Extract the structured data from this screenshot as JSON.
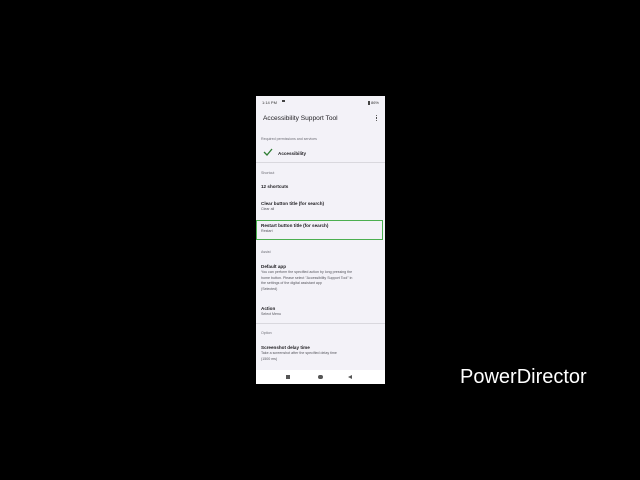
{
  "status_bar": {
    "time": "1:14 PM",
    "battery": "86%"
  },
  "app_bar": {
    "title": "Accessibility Support Tool"
  },
  "sections": {
    "required": "Required permissions and services",
    "shortcut": "Shortcut",
    "assist": "Assist",
    "option": "Option"
  },
  "accessibility": {
    "label": "Accessibility"
  },
  "items": {
    "shortcuts": {
      "title": "12 shortcuts"
    },
    "clear": {
      "title": "Clear button title (for search)",
      "summary": "Clear all"
    },
    "restart": {
      "title": "Restart button title (for search)",
      "summary": "Restart"
    },
    "default_app": {
      "title": "Default app",
      "summary_lines": [
        "You can perform the specified action by long pressing the",
        "home button. Please select \"Accessibility Support Tool\" in",
        "the settings of the digital assistant app",
        "(Selected)"
      ]
    },
    "action": {
      "title": "Action",
      "summary": "Select Menu"
    },
    "screenshot": {
      "title": "Screenshot delay time",
      "summary_lines": [
        "Take a screenshot after the specified delay time",
        "(1500 ms)"
      ]
    }
  },
  "watermark": "PowerDirector",
  "colors": {
    "highlight": "#4caf50",
    "check": "#2e7d32",
    "background": "#f3f2f8"
  }
}
